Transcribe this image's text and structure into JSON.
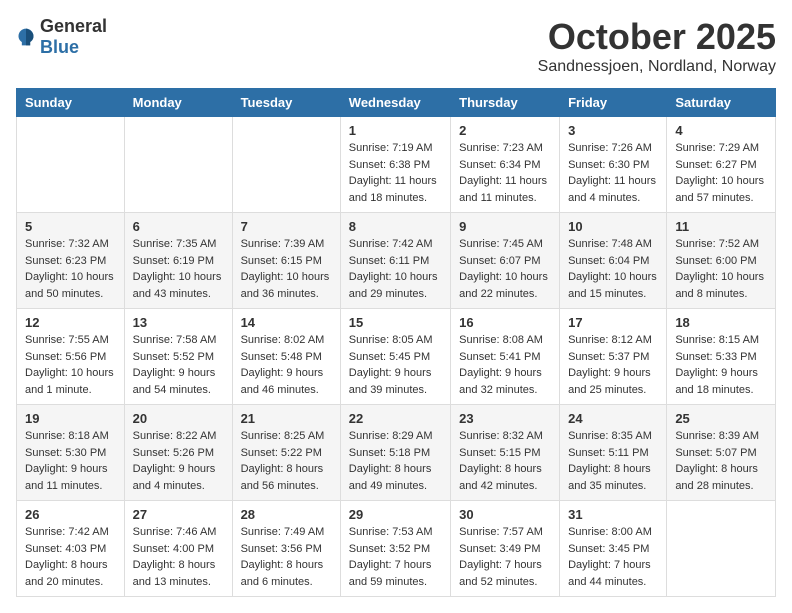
{
  "logo": {
    "general": "General",
    "blue": "Blue"
  },
  "header": {
    "month": "October 2025",
    "location": "Sandnessjoen, Nordland, Norway"
  },
  "weekdays": [
    "Sunday",
    "Monday",
    "Tuesday",
    "Wednesday",
    "Thursday",
    "Friday",
    "Saturday"
  ],
  "weeks": [
    [
      {
        "day": "",
        "info": ""
      },
      {
        "day": "",
        "info": ""
      },
      {
        "day": "",
        "info": ""
      },
      {
        "day": "1",
        "info": "Sunrise: 7:19 AM\nSunset: 6:38 PM\nDaylight: 11 hours\nand 18 minutes."
      },
      {
        "day": "2",
        "info": "Sunrise: 7:23 AM\nSunset: 6:34 PM\nDaylight: 11 hours\nand 11 minutes."
      },
      {
        "day": "3",
        "info": "Sunrise: 7:26 AM\nSunset: 6:30 PM\nDaylight: 11 hours\nand 4 minutes."
      },
      {
        "day": "4",
        "info": "Sunrise: 7:29 AM\nSunset: 6:27 PM\nDaylight: 10 hours\nand 57 minutes."
      }
    ],
    [
      {
        "day": "5",
        "info": "Sunrise: 7:32 AM\nSunset: 6:23 PM\nDaylight: 10 hours\nand 50 minutes."
      },
      {
        "day": "6",
        "info": "Sunrise: 7:35 AM\nSunset: 6:19 PM\nDaylight: 10 hours\nand 43 minutes."
      },
      {
        "day": "7",
        "info": "Sunrise: 7:39 AM\nSunset: 6:15 PM\nDaylight: 10 hours\nand 36 minutes."
      },
      {
        "day": "8",
        "info": "Sunrise: 7:42 AM\nSunset: 6:11 PM\nDaylight: 10 hours\nand 29 minutes."
      },
      {
        "day": "9",
        "info": "Sunrise: 7:45 AM\nSunset: 6:07 PM\nDaylight: 10 hours\nand 22 minutes."
      },
      {
        "day": "10",
        "info": "Sunrise: 7:48 AM\nSunset: 6:04 PM\nDaylight: 10 hours\nand 15 minutes."
      },
      {
        "day": "11",
        "info": "Sunrise: 7:52 AM\nSunset: 6:00 PM\nDaylight: 10 hours\nand 8 minutes."
      }
    ],
    [
      {
        "day": "12",
        "info": "Sunrise: 7:55 AM\nSunset: 5:56 PM\nDaylight: 10 hours\nand 1 minute."
      },
      {
        "day": "13",
        "info": "Sunrise: 7:58 AM\nSunset: 5:52 PM\nDaylight: 9 hours\nand 54 minutes."
      },
      {
        "day": "14",
        "info": "Sunrise: 8:02 AM\nSunset: 5:48 PM\nDaylight: 9 hours\nand 46 minutes."
      },
      {
        "day": "15",
        "info": "Sunrise: 8:05 AM\nSunset: 5:45 PM\nDaylight: 9 hours\nand 39 minutes."
      },
      {
        "day": "16",
        "info": "Sunrise: 8:08 AM\nSunset: 5:41 PM\nDaylight: 9 hours\nand 32 minutes."
      },
      {
        "day": "17",
        "info": "Sunrise: 8:12 AM\nSunset: 5:37 PM\nDaylight: 9 hours\nand 25 minutes."
      },
      {
        "day": "18",
        "info": "Sunrise: 8:15 AM\nSunset: 5:33 PM\nDaylight: 9 hours\nand 18 minutes."
      }
    ],
    [
      {
        "day": "19",
        "info": "Sunrise: 8:18 AM\nSunset: 5:30 PM\nDaylight: 9 hours\nand 11 minutes."
      },
      {
        "day": "20",
        "info": "Sunrise: 8:22 AM\nSunset: 5:26 PM\nDaylight: 9 hours\nand 4 minutes."
      },
      {
        "day": "21",
        "info": "Sunrise: 8:25 AM\nSunset: 5:22 PM\nDaylight: 8 hours\nand 56 minutes."
      },
      {
        "day": "22",
        "info": "Sunrise: 8:29 AM\nSunset: 5:18 PM\nDaylight: 8 hours\nand 49 minutes."
      },
      {
        "day": "23",
        "info": "Sunrise: 8:32 AM\nSunset: 5:15 PM\nDaylight: 8 hours\nand 42 minutes."
      },
      {
        "day": "24",
        "info": "Sunrise: 8:35 AM\nSunset: 5:11 PM\nDaylight: 8 hours\nand 35 minutes."
      },
      {
        "day": "25",
        "info": "Sunrise: 8:39 AM\nSunset: 5:07 PM\nDaylight: 8 hours\nand 28 minutes."
      }
    ],
    [
      {
        "day": "26",
        "info": "Sunrise: 7:42 AM\nSunset: 4:03 PM\nDaylight: 8 hours\nand 20 minutes."
      },
      {
        "day": "27",
        "info": "Sunrise: 7:46 AM\nSunset: 4:00 PM\nDaylight: 8 hours\nand 13 minutes."
      },
      {
        "day": "28",
        "info": "Sunrise: 7:49 AM\nSunset: 3:56 PM\nDaylight: 8 hours\nand 6 minutes."
      },
      {
        "day": "29",
        "info": "Sunrise: 7:53 AM\nSunset: 3:52 PM\nDaylight: 7 hours\nand 59 minutes."
      },
      {
        "day": "30",
        "info": "Sunrise: 7:57 AM\nSunset: 3:49 PM\nDaylight: 7 hours\nand 52 minutes."
      },
      {
        "day": "31",
        "info": "Sunrise: 8:00 AM\nSunset: 3:45 PM\nDaylight: 7 hours\nand 44 minutes."
      },
      {
        "day": "",
        "info": ""
      }
    ]
  ]
}
